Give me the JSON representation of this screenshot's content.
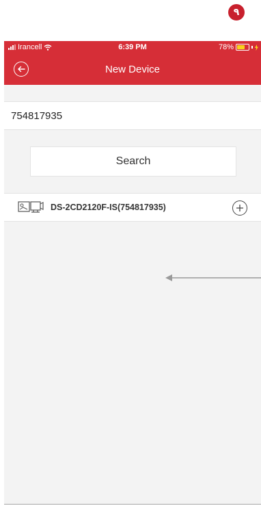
{
  "step_badge": "٩",
  "status_bar": {
    "carrier": "Irancell",
    "time": "6:39 PM",
    "battery_percent": "78%",
    "battery_level": 0.78
  },
  "navbar": {
    "title": "New Device",
    "back_icon": "back-circle-icon"
  },
  "search": {
    "value": "754817935",
    "button_label": "Search"
  },
  "results": [
    {
      "name": "DS-2CD2120F-IS(754817935)",
      "icon": "device-camera-icon",
      "action_icon": "add-circle-icon"
    }
  ],
  "colors": {
    "header_red": "#d62e37",
    "badge_red": "#c8202d",
    "battery_yellow": "#f7d21c",
    "background": "#f3f3f3"
  }
}
